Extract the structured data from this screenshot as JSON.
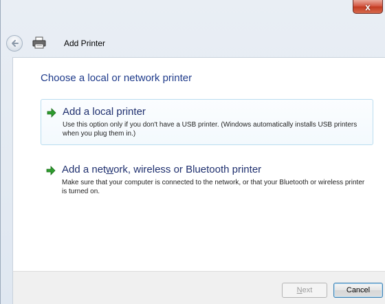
{
  "window": {
    "close_label": "x"
  },
  "nav": {
    "title": "Add Printer"
  },
  "main": {
    "heading": "Choose a local or network printer",
    "options": [
      {
        "title_pre": "Add a local printer",
        "description": "Use this option only if you don't have a USB printer. (Windows automatically installs USB printers when you plug them in.)"
      },
      {
        "title_pre": "Add a net",
        "title_access": "w",
        "title_post": "ork, wireless or Bluetooth printer",
        "description": "Make sure that your computer is connected to the network, or that your Bluetooth or wireless printer is turned on."
      }
    ]
  },
  "footer": {
    "next_access": "N",
    "next_rest": "ext",
    "cancel_label": "Cancel"
  },
  "colors": {
    "accent_heading": "#1e3a8a",
    "arrow_green": "#2e9d2e"
  }
}
